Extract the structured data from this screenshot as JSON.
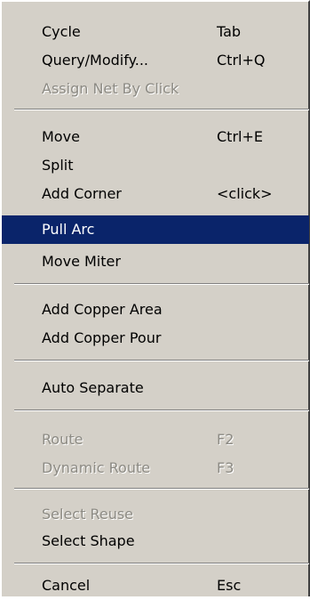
{
  "menu": {
    "items": [
      {
        "label": "Cycle",
        "shortcut": "Tab"
      },
      {
        "label": "Query/Modify...",
        "shortcut": "Ctrl+Q"
      },
      {
        "label": "Assign Net By Click",
        "shortcut": "",
        "disabled": true
      },
      {
        "label": "Move",
        "shortcut": "Ctrl+E"
      },
      {
        "label": "Split",
        "shortcut": ""
      },
      {
        "label": "Add Corner",
        "shortcut": "<click>"
      },
      {
        "label": "Pull Arc",
        "shortcut": "",
        "selected": true
      },
      {
        "label": "Move Miter",
        "shortcut": ""
      },
      {
        "label": "Add Copper Area",
        "shortcut": ""
      },
      {
        "label": "Add Copper Pour",
        "shortcut": ""
      },
      {
        "label": "Auto Separate",
        "shortcut": ""
      },
      {
        "label": "Route",
        "shortcut": "F2",
        "disabled": true
      },
      {
        "label": "Dynamic Route",
        "shortcut": "F3",
        "disabled": true
      },
      {
        "label": "Select Reuse",
        "shortcut": "",
        "disabled": true
      },
      {
        "label": "Select Shape",
        "shortcut": ""
      },
      {
        "label": "Cancel",
        "shortcut": "Esc"
      }
    ],
    "colors": {
      "background": "#d4d0c8",
      "highlight": "#0a246a",
      "disabled_text": "#8c8a83"
    }
  }
}
